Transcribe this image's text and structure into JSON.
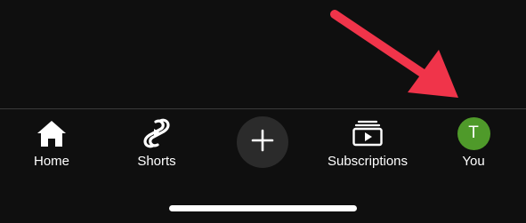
{
  "colors": {
    "background": "#0f0f0f",
    "arrow": "#f0344a",
    "avatar": "#4f9a2a",
    "create_button_bg": "#2b2b2b"
  },
  "annotation": {
    "icon": "red-arrow-pointing-to-you-tab"
  },
  "bottom_nav": {
    "tabs": [
      {
        "id": "home",
        "label": "Home",
        "icon": "home-icon"
      },
      {
        "id": "shorts",
        "label": "Shorts",
        "icon": "shorts-icon"
      },
      {
        "id": "create",
        "label": "",
        "icon": "plus-icon"
      },
      {
        "id": "subscriptions",
        "label": "Subscriptions",
        "icon": "subscriptions-icon"
      },
      {
        "id": "you",
        "label": "You",
        "icon": "avatar"
      }
    ],
    "avatar_initial": "T"
  }
}
